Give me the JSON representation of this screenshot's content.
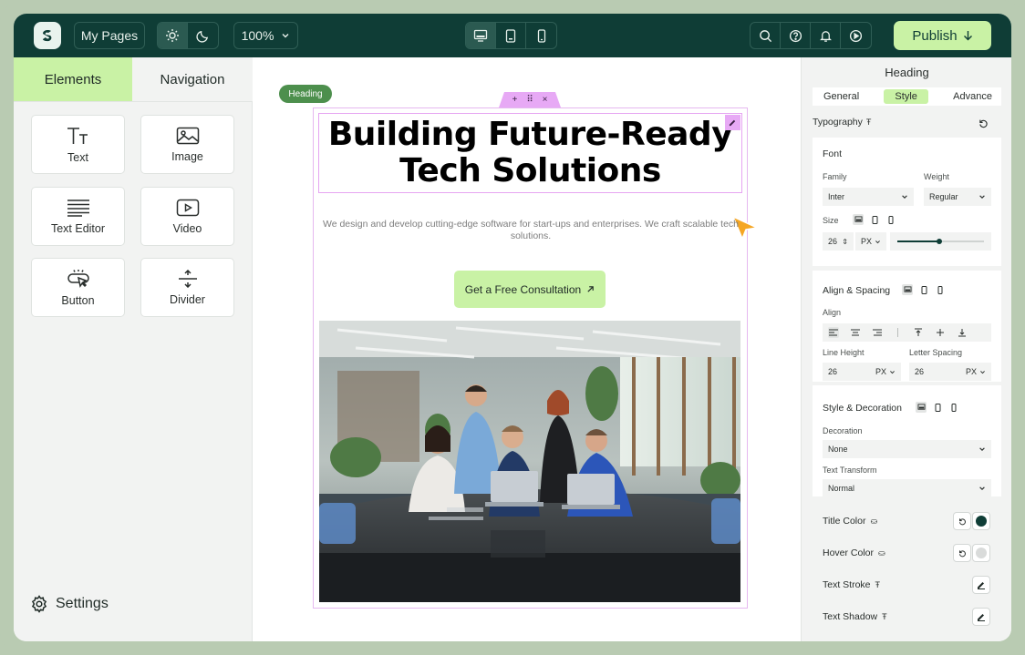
{
  "topbar": {
    "my_pages": "My Pages",
    "zoom": "100%",
    "publish": "Publish"
  },
  "left_panel": {
    "tabs": [
      "Elements",
      "Navigation"
    ],
    "tiles": [
      {
        "label": "Text",
        "icon": "text-icon"
      },
      {
        "label": "Image",
        "icon": "image-icon"
      },
      {
        "label": "Text Editor",
        "icon": "text-editor-icon"
      },
      {
        "label": "Video",
        "icon": "video-icon"
      },
      {
        "label": "Button",
        "icon": "button-icon"
      },
      {
        "label": "Divider",
        "icon": "divider-icon"
      }
    ],
    "settings": "Settings"
  },
  "canvas": {
    "badge": "Heading",
    "heading_line1": "Building Future-Ready",
    "heading_line2": "Tech Solutions",
    "subtext": "We design and develop cutting-edge software for start-ups and enterprises. We craft scalable tech solutions.",
    "cta": "Get a Free Consultation"
  },
  "right_panel": {
    "title": "Heading",
    "tabs": [
      "General",
      "Style",
      "Advance"
    ],
    "typography": "Typography",
    "font": {
      "section": "Font",
      "family_label": "Family",
      "family_value": "Inter",
      "weight_label": "Weight",
      "weight_value": "Regular",
      "size_label": "Size",
      "size_value": "26",
      "size_unit": "PX",
      "size_slider_fraction": 0.48
    },
    "align": {
      "section": "Align & Spacing",
      "align_label": "Align",
      "line_height_label": "Line Height",
      "line_height_value": "26",
      "line_height_unit": "PX",
      "letter_spacing_label": "Letter Spacing",
      "letter_spacing_value": "26",
      "letter_spacing_unit": "PX"
    },
    "decoration": {
      "section": "Style & Decoration",
      "decoration_label": "Decoration",
      "decoration_value": "None",
      "transform_label": "Text Transform",
      "transform_value": "Normal"
    },
    "rows": {
      "title_color": "Title Color",
      "hover_color": "Hover Color",
      "text_stroke": "Text Stroke",
      "text_shadow": "Text Shadow"
    },
    "colors": {
      "title_color": "#0f3d36",
      "hover_color": "#d9dbda"
    }
  },
  "colors": {
    "topbar": "#0f3d36",
    "accent": "#c9f2a5",
    "selection": "#e6a5f2",
    "cursor": "#f5a623"
  }
}
